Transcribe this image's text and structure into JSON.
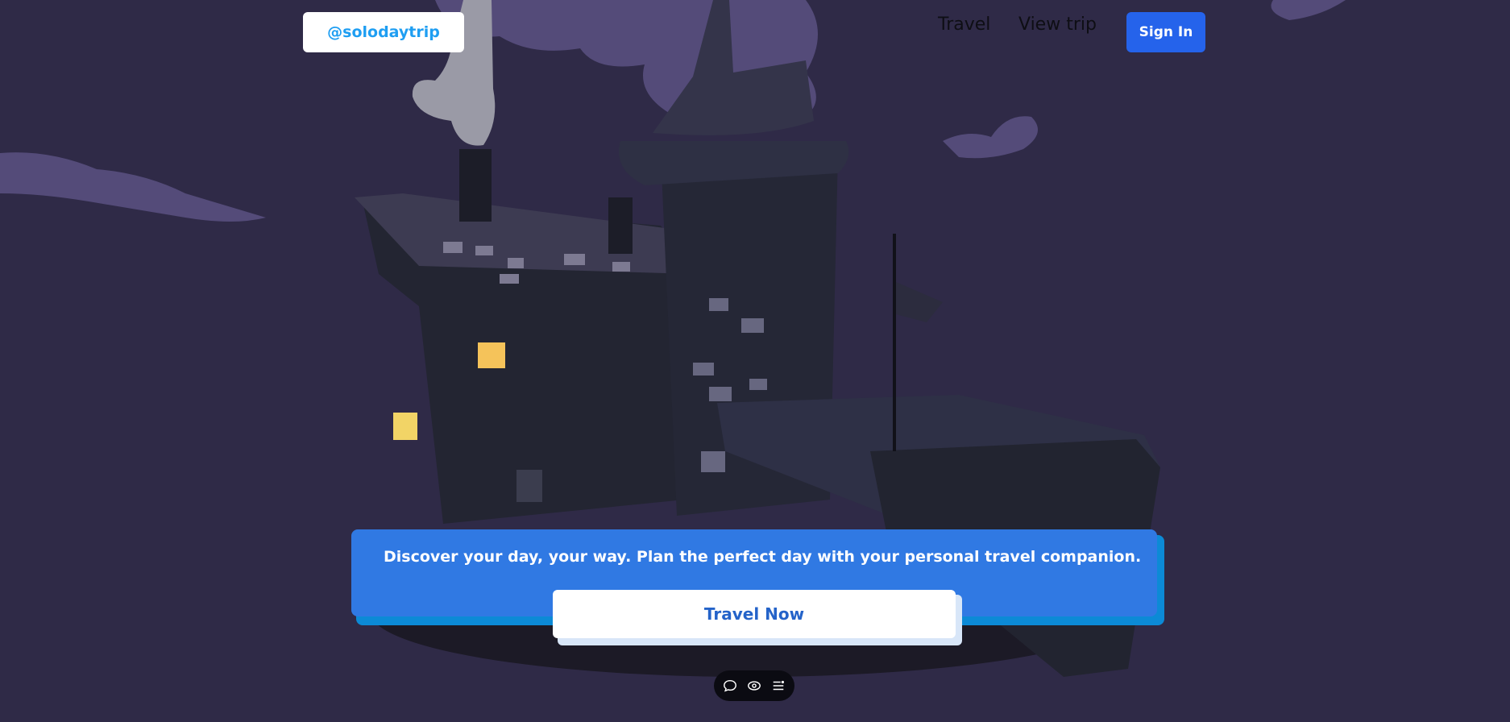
{
  "header": {
    "logo_text": "@solodaytrip",
    "nav": [
      {
        "label": "Travel"
      },
      {
        "label": "View trip"
      }
    ],
    "signin_label": "Sign In"
  },
  "hero": {
    "tagline": "Discover your day, your way. Plan the perfect day with your personal travel companion.",
    "cta_label": "Travel Now"
  },
  "toolbar": {
    "icons": [
      "comment-icon",
      "eye-icon",
      "menu-list-icon"
    ]
  },
  "colors": {
    "background": "#2f2a47",
    "brand_accent": "#1e9ef2",
    "signin_button": "#2563eb",
    "banner": "#3079e3",
    "banner_shadow": "#0c8ad6",
    "cta_text": "#2463c9"
  }
}
